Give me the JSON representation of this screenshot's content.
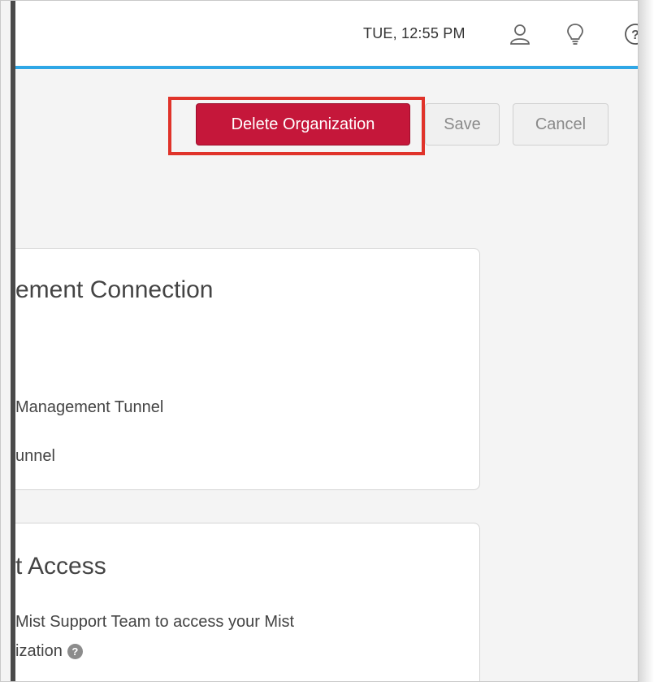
{
  "header": {
    "datetime": "TUE, 12:55 PM",
    "icons": [
      "user-icon",
      "lightbulb-icon",
      "help-icon"
    ],
    "accent_color": "#2fa7e6"
  },
  "actions": {
    "delete_label": "Delete Organization",
    "save_label": "Save",
    "cancel_label": "Cancel",
    "delete_color": "#c5173a",
    "highlight_color": "#e0332a"
  },
  "cards": {
    "management": {
      "title": "ement Connection",
      "line1": "Management Tunnel",
      "line2": "unnel"
    },
    "support": {
      "title": "t Access",
      "line1": "Mist Support Team to access your Mist",
      "line2": "ization"
    }
  }
}
